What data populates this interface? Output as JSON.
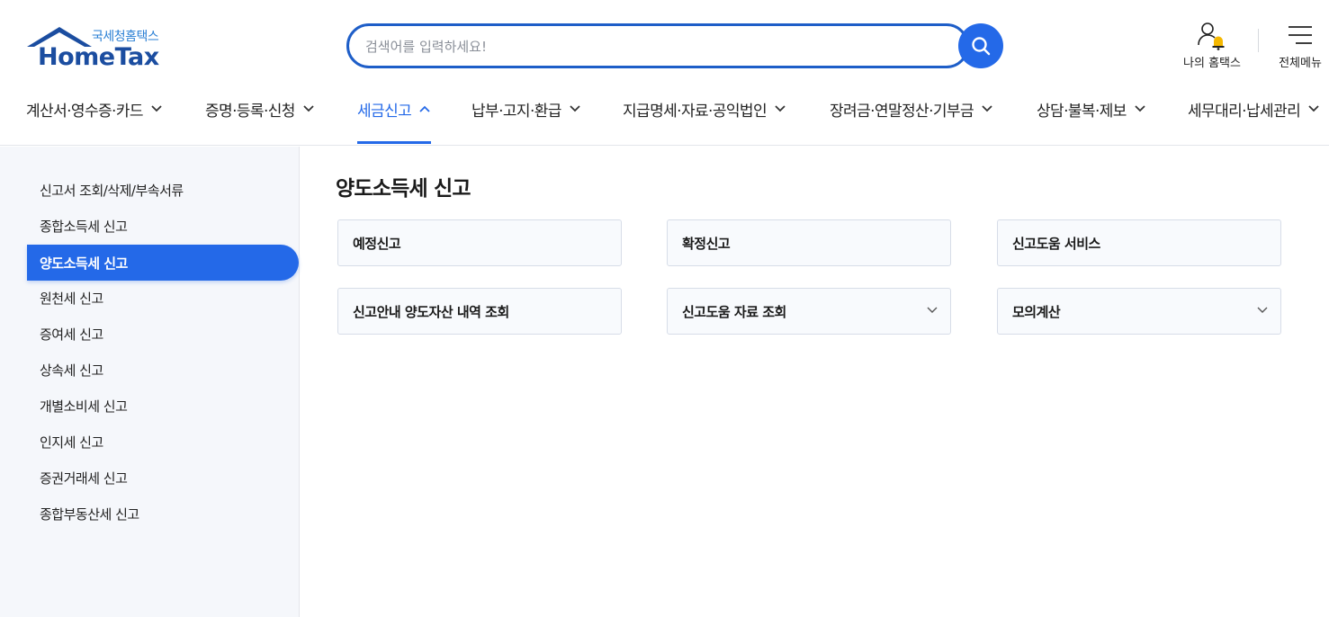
{
  "header": {
    "logo_sub": "국세청홈택스",
    "logo_main": "HomeTax",
    "search_placeholder": "검색어를 입력하세요!",
    "my_hometax_label": "나의 홈택스",
    "all_menu_label": "전체메뉴"
  },
  "gnb": {
    "items": [
      {
        "label": "계산서·영수증·카드",
        "active": false
      },
      {
        "label": "증명·등록·신청",
        "active": false
      },
      {
        "label": "세금신고",
        "active": true
      },
      {
        "label": "납부·고지·환급",
        "active": false
      },
      {
        "label": "지급명세·자료·공익법인",
        "active": false
      },
      {
        "label": "장려금·연말정산·기부금",
        "active": false
      },
      {
        "label": "상담·불복·제보",
        "active": false
      },
      {
        "label": "세무대리·납세관리",
        "active": false
      }
    ]
  },
  "sidebar": {
    "items": [
      {
        "label": "신고서 조회/삭제/부속서류",
        "active": false
      },
      {
        "label": "종합소득세 신고",
        "active": false
      },
      {
        "label": "양도소득세 신고",
        "active": true
      },
      {
        "label": "원천세 신고",
        "active": false
      },
      {
        "label": "증여세 신고",
        "active": false
      },
      {
        "label": "상속세 신고",
        "active": false
      },
      {
        "label": "개별소비세 신고",
        "active": false
      },
      {
        "label": "인지세 신고",
        "active": false
      },
      {
        "label": "증권거래세 신고",
        "active": false
      },
      {
        "label": "종합부동산세 신고",
        "active": false
      }
    ]
  },
  "main": {
    "title": "양도소득세 신고",
    "cards": [
      {
        "label": "예정신고",
        "has_dropdown": false
      },
      {
        "label": "확정신고",
        "has_dropdown": false
      },
      {
        "label": "신고도움 서비스",
        "has_dropdown": false
      },
      {
        "label": "신고안내 양도자산 내역 조회",
        "has_dropdown": false
      },
      {
        "label": "신고도움 자료 조회",
        "has_dropdown": true
      },
      {
        "label": "모의계산",
        "has_dropdown": true
      }
    ]
  },
  "colors": {
    "accent": "#2469e8",
    "logo_blue": "#1b4da0",
    "bell_yellow": "#f5b800",
    "sidebar_bg": "#f5f7fb"
  },
  "icons": {
    "search": "search-icon",
    "my_hometax": "user-bell-icon",
    "all_menu": "hamburger-icon",
    "chevron": "chevron-down-icon",
    "chevron_up": "chevron-up-icon"
  }
}
